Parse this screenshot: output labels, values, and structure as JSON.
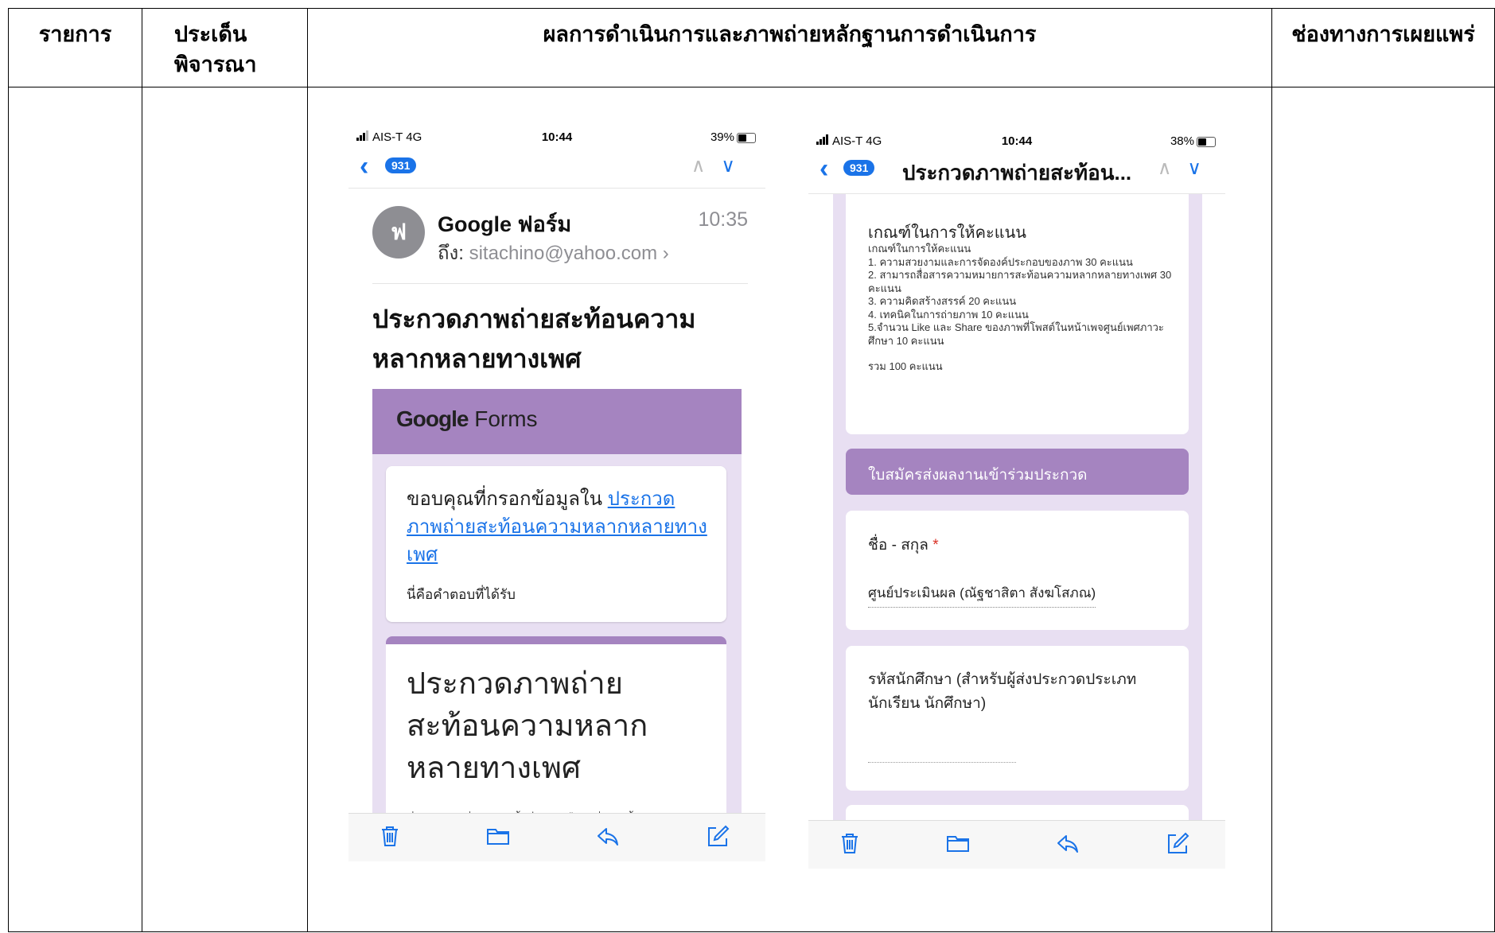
{
  "table": {
    "headers": [
      "รายการ",
      "ประเด็นพิจารณา",
      "ผลการดำเนินการและภาพถ่ายหลักฐานการดำเนินการ",
      "ช่องทางการเผยแพร่"
    ]
  },
  "phone1": {
    "carrier": "AIS-T 4G",
    "time": "10:44",
    "battery": "39%",
    "badge": "931",
    "sender_initial": "ฟ",
    "sender": "Google ฟอร์ม",
    "received_time": "10:35",
    "to_label": "ถึง:",
    "to_email": "sitachino@yahoo.com",
    "subject": "ประกวดภาพถ่ายสะท้อนความหลากหลายทางเพศ",
    "forms_brand_google": "Google",
    "forms_brand_forms": "Forms",
    "thanks_prefix": "ขอบคุณที่กรอกข้อมูลใน",
    "thanks_link": "ประกวดภาพถ่ายสะท้อนความหลากหลายทางเพศ",
    "response_note": "นี่คือคำตอบที่ได้รับ",
    "form_title": "ประกวดภาพถ่ายสะท้อนความหลากหลายทางเพศ",
    "form_desc": "ช่องทางการส่งผลงานเข้าประกวด \"ภาพถ่ายสะท้อน"
  },
  "phone2": {
    "carrier": "AIS-T 4G",
    "time": "10:44",
    "battery": "38%",
    "badge": "931",
    "nav_title": "ประกวดภาพถ่ายสะท้อน...",
    "criteria_title": "เกณฑ์ในการให้คะแนน",
    "criteria_sub": "เกณฑ์ในการให้คะแนน",
    "criteria_items": [
      "1. ความสวยงามและการจัดองค์ประกอบของภาพ 30 คะแนน",
      "2. สามารถสื่อสารความหมายการสะท้อนความหลากหลายทางเพศ 30 คะแนน",
      "3. ความคิดสร้างสรรค์ 20 คะแนน",
      "4. เทคนิคในการถ่ายภาพ 10 คะแนน",
      "5.จำนวน Like และ Share ของภาพที่โพสต์ในหน้าเพจศูนย์เพศภาวะศึกษา 10 คะแนน"
    ],
    "criteria_total": "รวม 100 คะแนน",
    "section_header": "ใบสมัครส่งผลงานเข้าร่วมประกวด",
    "name_label": "ชื่อ - สกุล",
    "required_mark": "*",
    "name_answer": "ศูนย์ประเมินผล (ณัฐชาสิตา สังฆโสภณ)",
    "student_id_label": "รหัสนักศึกษา (สำหรับผู้ส่งประกวดประเภทนักเรียน นักศึกษา)"
  }
}
